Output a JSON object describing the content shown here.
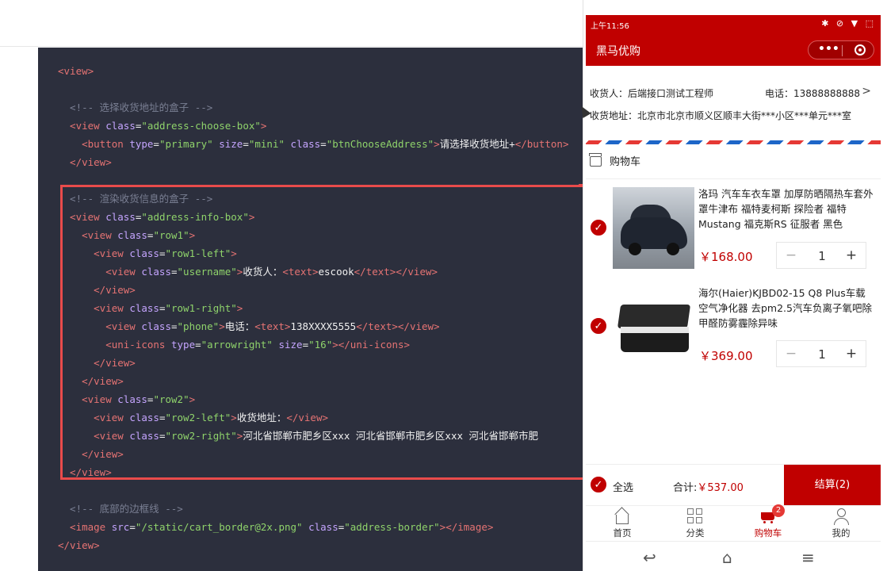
{
  "code_lines": [
    [
      {
        "t": "tag",
        "v": "<view>"
      }
    ],
    [],
    [
      {
        "t": "com",
        "v": "  <!-- 选择收货地址的盒子 -->"
      }
    ],
    [
      {
        "t": "tag",
        "v": "  <view "
      },
      {
        "t": "attr",
        "v": "class"
      },
      {
        "t": "txt",
        "v": "="
      },
      {
        "t": "val",
        "v": "\"address-choose-box\""
      },
      {
        "t": "tag",
        "v": ">"
      }
    ],
    [
      {
        "t": "tag",
        "v": "    <button "
      },
      {
        "t": "attr",
        "v": "type"
      },
      {
        "t": "txt",
        "v": "="
      },
      {
        "t": "val",
        "v": "\"primary\""
      },
      {
        "t": "attr",
        "v": " size"
      },
      {
        "t": "txt",
        "v": "="
      },
      {
        "t": "val",
        "v": "\"mini\""
      },
      {
        "t": "attr",
        "v": " class"
      },
      {
        "t": "txt",
        "v": "="
      },
      {
        "t": "val",
        "v": "\"btnChooseAddress\""
      },
      {
        "t": "tag",
        "v": ">"
      },
      {
        "t": "txt",
        "v": "请选择收货地址+"
      },
      {
        "t": "tag",
        "v": "</button>"
      }
    ],
    [
      {
        "t": "tag",
        "v": "  </view>"
      }
    ],
    [],
    [
      {
        "t": "com",
        "v": "  <!-- 渲染收货信息的盒子 -->"
      }
    ],
    [
      {
        "t": "tag",
        "v": "  <view "
      },
      {
        "t": "attr",
        "v": "class"
      },
      {
        "t": "txt",
        "v": "="
      },
      {
        "t": "val",
        "v": "\"address-info-box\""
      },
      {
        "t": "tag",
        "v": ">"
      }
    ],
    [
      {
        "t": "tag",
        "v": "    <view "
      },
      {
        "t": "attr",
        "v": "class"
      },
      {
        "t": "txt",
        "v": "="
      },
      {
        "t": "val",
        "v": "\"row1\""
      },
      {
        "t": "tag",
        "v": ">"
      }
    ],
    [
      {
        "t": "tag",
        "v": "      <view "
      },
      {
        "t": "attr",
        "v": "class"
      },
      {
        "t": "txt",
        "v": "="
      },
      {
        "t": "val",
        "v": "\"row1-left\""
      },
      {
        "t": "tag",
        "v": ">"
      }
    ],
    [
      {
        "t": "tag",
        "v": "        <view "
      },
      {
        "t": "attr",
        "v": "class"
      },
      {
        "t": "txt",
        "v": "="
      },
      {
        "t": "val",
        "v": "\"username\""
      },
      {
        "t": "tag",
        "v": ">"
      },
      {
        "t": "txt",
        "v": "收货人："
      },
      {
        "t": "tag",
        "v": "<text>"
      },
      {
        "t": "txt",
        "v": "escook"
      },
      {
        "t": "tag",
        "v": "</text></view>"
      }
    ],
    [
      {
        "t": "tag",
        "v": "      </view>"
      }
    ],
    [
      {
        "t": "tag",
        "v": "      <view "
      },
      {
        "t": "attr",
        "v": "class"
      },
      {
        "t": "txt",
        "v": "="
      },
      {
        "t": "val",
        "v": "\"row1-right\""
      },
      {
        "t": "tag",
        "v": ">"
      }
    ],
    [
      {
        "t": "tag",
        "v": "        <view "
      },
      {
        "t": "attr",
        "v": "class"
      },
      {
        "t": "txt",
        "v": "="
      },
      {
        "t": "val",
        "v": "\"phone\""
      },
      {
        "t": "tag",
        "v": ">"
      },
      {
        "t": "txt",
        "v": "电话："
      },
      {
        "t": "tag",
        "v": "<text>"
      },
      {
        "t": "txt",
        "v": "138XXXX5555"
      },
      {
        "t": "tag",
        "v": "</text></view>"
      }
    ],
    [
      {
        "t": "tag",
        "v": "        <uni-icons "
      },
      {
        "t": "attr",
        "v": "type"
      },
      {
        "t": "txt",
        "v": "="
      },
      {
        "t": "val",
        "v": "\"arrowright\""
      },
      {
        "t": "attr",
        "v": " size"
      },
      {
        "t": "txt",
        "v": "="
      },
      {
        "t": "val",
        "v": "\"16\""
      },
      {
        "t": "tag",
        "v": "></uni-icons>"
      }
    ],
    [
      {
        "t": "tag",
        "v": "      </view>"
      }
    ],
    [
      {
        "t": "tag",
        "v": "    </view>"
      }
    ],
    [
      {
        "t": "tag",
        "v": "    <view "
      },
      {
        "t": "attr",
        "v": "class"
      },
      {
        "t": "txt",
        "v": "="
      },
      {
        "t": "val",
        "v": "\"row2\""
      },
      {
        "t": "tag",
        "v": ">"
      }
    ],
    [
      {
        "t": "tag",
        "v": "      <view "
      },
      {
        "t": "attr",
        "v": "class"
      },
      {
        "t": "txt",
        "v": "="
      },
      {
        "t": "val",
        "v": "\"row2-left\""
      },
      {
        "t": "tag",
        "v": ">"
      },
      {
        "t": "txt",
        "v": "收货地址："
      },
      {
        "t": "tag",
        "v": "</view>"
      }
    ],
    [
      {
        "t": "tag",
        "v": "      <view "
      },
      {
        "t": "attr",
        "v": "class"
      },
      {
        "t": "txt",
        "v": "="
      },
      {
        "t": "val",
        "v": "\"row2-right\""
      },
      {
        "t": "tag",
        "v": ">"
      },
      {
        "t": "txt",
        "v": "河北省邯郸市肥乡区xxx 河北省邯郸市肥乡区xxx 河北省邯郸市肥"
      }
    ],
    [
      {
        "t": "tag",
        "v": "    </view>"
      }
    ],
    [
      {
        "t": "tag",
        "v": "  </view>"
      }
    ],
    [],
    [
      {
        "t": "com",
        "v": "  <!-- 底部的边框线 -->"
      }
    ],
    [
      {
        "t": "tag",
        "v": "  <image "
      },
      {
        "t": "attr",
        "v": "src"
      },
      {
        "t": "txt",
        "v": "="
      },
      {
        "t": "val",
        "v": "\"/static/cart_border@2x.png\""
      },
      {
        "t": "attr",
        "v": " class"
      },
      {
        "t": "txt",
        "v": "="
      },
      {
        "t": "val",
        "v": "\"address-border\""
      },
      {
        "t": "tag",
        "v": "></image>"
      }
    ],
    [
      {
        "t": "tag",
        "v": "</view>"
      }
    ]
  ],
  "phone": {
    "status_time": "上午11:56",
    "status_icons": "✱ ⊘ ▼ ⬚",
    "nav_title": "黑马优购",
    "capsule_dots": "•••",
    "address": {
      "receiver": "收货人：后端接口测试工程师",
      "phone": "电话：13888888888",
      "arrow": ">",
      "address_line": "收货地址：北京市北京市顺义区顺丰大街***小区***单元***室"
    },
    "shop_label": "购物车",
    "goods": [
      {
        "name": "洛玛 汽车车衣车罩 加厚防晒隔热车套外罩牛津布 福特麦柯斯 探险者 福特Mustang 福克斯RS 征服者 黑色",
        "price": "￥168.00",
        "count": "1"
      },
      {
        "name": "海尔(Haier)KJBD02-15 Q8 Plus车载空气净化器 去pm2.5汽车负离子氧吧除甲醛防雾霾除异味",
        "price": "￥369.00",
        "count": "1"
      }
    ],
    "stepper": {
      "minus": "−",
      "plus": "+"
    },
    "check_mark": "✓",
    "select_all": "全选",
    "total_label": "合计:",
    "total_amount": "￥537.00",
    "checkout": "结算(2)",
    "tabs": [
      {
        "label": "首页"
      },
      {
        "label": "分类"
      },
      {
        "label": "购物车",
        "badge": "2"
      },
      {
        "label": "我的"
      }
    ],
    "sysnav": {
      "back": "↩",
      "home": "⌂",
      "menu": "≡"
    }
  },
  "colors": {
    "brand": "#c00000",
    "highlight": "#e94b4b",
    "editor_bg": "#2c2f3d"
  }
}
